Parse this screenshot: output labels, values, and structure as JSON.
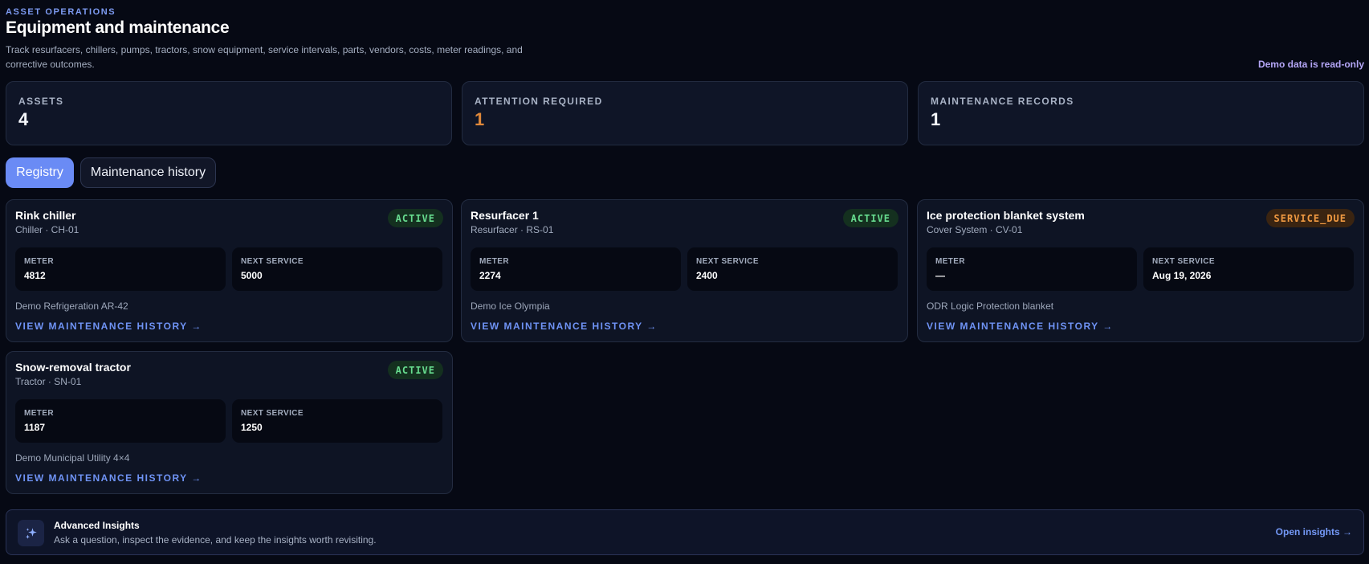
{
  "header": {
    "eyebrow": "ASSET OPERATIONS",
    "title": "Equipment and maintenance",
    "description": "Track resurfacers, chillers, pumps, tractors, snow equipment, service intervals, parts, vendors, costs, meter readings, and corrective outcomes.",
    "readonly_note": "Demo data is read-only"
  },
  "stats": [
    {
      "label": "ASSETS",
      "value": "4"
    },
    {
      "label": "ATTENTION REQUIRED",
      "value": "1"
    },
    {
      "label": "MAINTENANCE RECORDS",
      "value": "1"
    }
  ],
  "tabs": [
    {
      "label": "Registry",
      "active": true
    },
    {
      "label": "Maintenance history",
      "active": false
    }
  ],
  "metric_labels": {
    "meter": "METER",
    "next_service": "NEXT SERVICE"
  },
  "assets": [
    {
      "name": "Rink chiller",
      "subtitle": "Chiller · CH-01",
      "status": "ACTIVE",
      "meter": "4812",
      "next_service": "5000",
      "vendor": "Demo Refrigeration AR-42",
      "link": "VIEW MAINTENANCE HISTORY →"
    },
    {
      "name": "Resurfacer 1",
      "subtitle": "Resurfacer · RS-01",
      "status": "ACTIVE",
      "meter": "2274",
      "next_service": "2400",
      "vendor": "Demo Ice Olympia",
      "link": "VIEW MAINTENANCE HISTORY →"
    },
    {
      "name": "Ice protection blanket system",
      "subtitle": "Cover System · CV-01",
      "status": "SERVICE_DUE",
      "meter": "—",
      "next_service": "Aug 19, 2026",
      "vendor": "ODR Logic Protection blanket",
      "link": "VIEW MAINTENANCE HISTORY →"
    },
    {
      "name": "Snow-removal tractor",
      "subtitle": "Tractor · SN-01",
      "status": "ACTIVE",
      "meter": "1187",
      "next_service": "1250",
      "vendor": "Demo Municipal Utility 4×4",
      "link": "VIEW MAINTENANCE HISTORY →"
    }
  ],
  "insights": {
    "icon": "sparkles-icon",
    "title": "Advanced Insights",
    "description": "Ask a question, inspect the evidence, and keep the insights worth revisiting.",
    "open_label": "Open insights →"
  },
  "colors": {
    "accent": "#6a8bf5",
    "active": "#67dc8f",
    "service_due": "#f19a42",
    "attention": "#e0883a"
  }
}
